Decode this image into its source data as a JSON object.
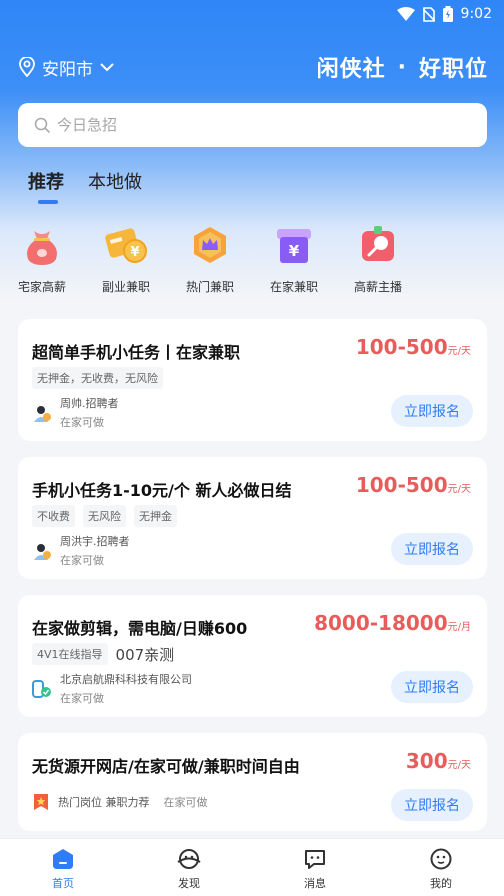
{
  "status": {
    "time": "9:02"
  },
  "header": {
    "city": "安阳市",
    "brand_left": "闲侠社",
    "brand_dot": "·",
    "brand_right": "好职位"
  },
  "search": {
    "placeholder": "今日急招"
  },
  "tabs": [
    {
      "label": "推荐",
      "active": true
    },
    {
      "label": "本地做",
      "active": false
    }
  ],
  "categories": [
    {
      "label": "宅家高薪",
      "icon": "money-bag-icon"
    },
    {
      "label": "副业兼职",
      "icon": "coin-card-icon"
    },
    {
      "label": "热门兼职",
      "icon": "crown-icon"
    },
    {
      "label": "在家兼职",
      "icon": "gift-box-icon"
    },
    {
      "label": "高薪主播",
      "icon": "microphone-icon"
    }
  ],
  "jobs": [
    {
      "title": "超简单手机小任务丨在家兼职",
      "salary": "100-500",
      "unit": "元/天",
      "tags": [
        "无押金，无收费，无风险"
      ],
      "poster": "周帅.招聘者",
      "location": "在家可做",
      "apply": "立即报名"
    },
    {
      "title": "手机小任务1-10元/个 新人必做日结",
      "salary": "100-500",
      "unit": "元/天",
      "tags": [
        "不收费",
        "无风险",
        "无押金"
      ],
      "poster": "周洪宇.招聘者",
      "location": "在家可做",
      "apply": "立即报名"
    },
    {
      "title": "在家做剪辑，需电脑/日赚600",
      "salary": "8000-18000",
      "unit": "元/月",
      "tags": [
        "4V1在线指导"
      ],
      "extra_tag": "007亲测",
      "poster": "北京启航鼎科科技有限公司",
      "location": "在家可做",
      "apply": "立即报名"
    },
    {
      "title": "无货源开网店/在家可做/兼职时间自由",
      "salary": "300",
      "unit": "元/天",
      "hot_label": "热门岗位 兼职力荐",
      "location": "在家可做",
      "apply": "立即报名"
    }
  ],
  "nav": [
    {
      "label": "首页",
      "active": true
    },
    {
      "label": "发现",
      "active": false
    },
    {
      "label": "消息",
      "active": false
    },
    {
      "label": "我的",
      "active": false
    }
  ],
  "colors": {
    "accent": "#2f7cf6",
    "salary": "#e95c5c"
  }
}
